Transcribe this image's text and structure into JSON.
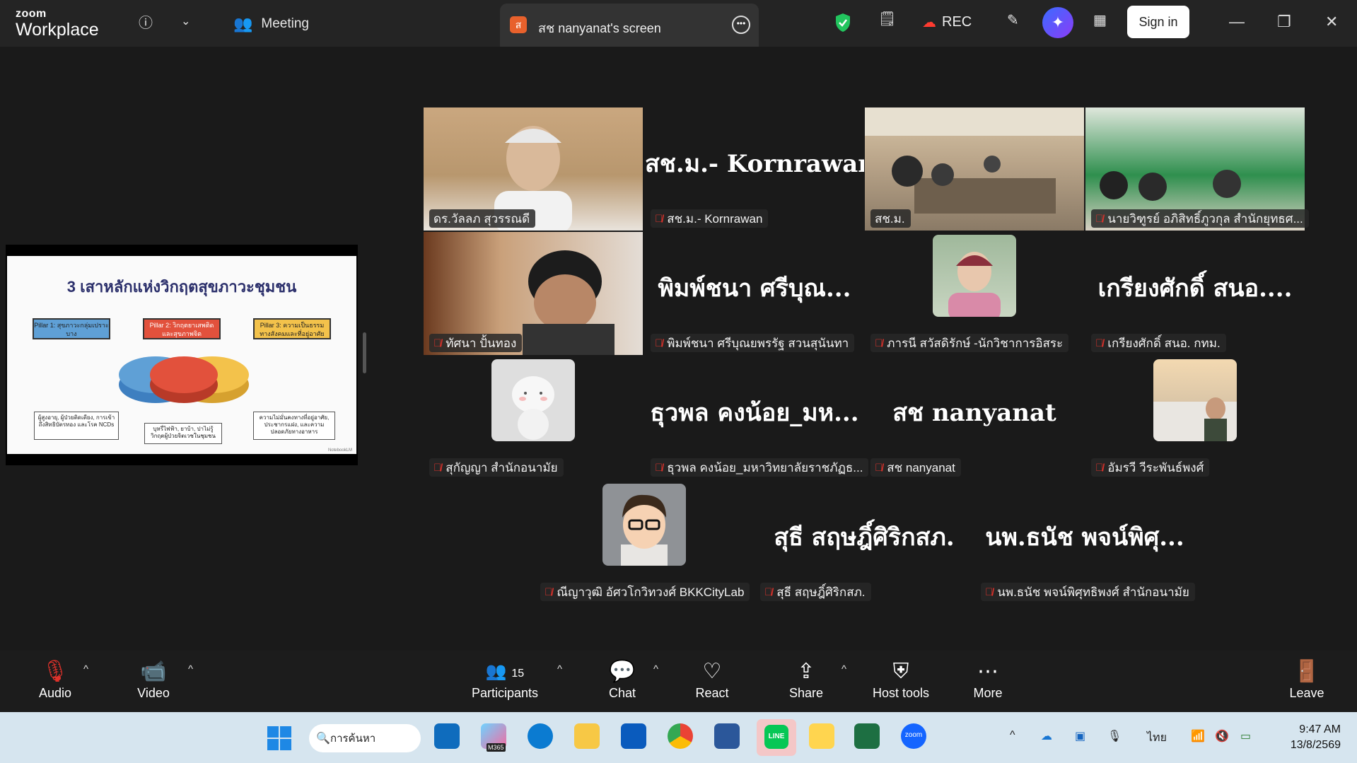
{
  "titlebar": {
    "brand_top": "zoom",
    "brand_bottom": "Workplace",
    "meeting_label": "Meeting",
    "screen_tab_avatar": "ส",
    "screen_tab_label": "สช nanyanat's screen",
    "rec_label": "REC",
    "signin_label": "Sign in",
    "icons": [
      "info-icon",
      "chevron-down-icon",
      "participants-icon",
      "more-icon",
      "shield-icon",
      "notes-icon",
      "cloud-rec-icon",
      "pen-icon",
      "ai-companion-icon",
      "layout-icon",
      "minimize-icon",
      "restore-icon",
      "close-icon"
    ]
  },
  "slide": {
    "title": "3 เสาหลักแห่งวิกฤตสุขภาวะชุมชน",
    "pillar1": "Pillar 1: สุขภาวะกลุ่มเปราะบาง",
    "pillar2": "Pillar 2: วิกฤตยาเสพติด และสุขภาพจิต",
    "pillar3": "Pillar 3: ความเป็นธรรม ทางสังคมและที่อยู่อาศัย",
    "note1": "ผู้สูงอายุ, ผู้ป่วยติดเตียง, การเข้าถึงสิทธิบัตรทอง และโรค NCDs",
    "note2": "บุหรี่ไฟฟ้า, ยาบ้า, ปาไม่รู้ วิกฤตผู้ป่วยจิตเวชในชุมชน",
    "note3": "ความไม่มั่นคงทางที่อยู่อาศัย, ประชากรแฝง, และความ ปลอดภัยทางอาหาร",
    "footer": "NotebookLM",
    "colors": {
      "pillar1": "#5fa0d6",
      "pillar2": "#e2513c",
      "pillar3": "#f3c24b"
    }
  },
  "participants": [
    {
      "name": "ดร.วัลลภ สุวรรณดี",
      "type": "video"
    },
    {
      "name": "สช.ม.- Kornrawan",
      "bigname": "สช.ม.- Kornrawan",
      "type": "name",
      "muted": true
    },
    {
      "name": "สช.ม.",
      "type": "video",
      "active": true
    },
    {
      "name": "นายวิฑูรย์ อภิสิทธิ์ภูวกุล สำนักยุทธศ...",
      "type": "video",
      "muted": true
    },
    {
      "name": "ทัศนา ปั้นทอง",
      "type": "video",
      "muted": true
    },
    {
      "name": "พิมพ์ชนา ศรีบุณยพรรัฐ สวนสุนันทา",
      "bigname": "พิมพ์ชนา ศรีบุณ...",
      "type": "name",
      "muted": true
    },
    {
      "name": "ภารนี สวัสดิรักษ์ -นักวิชาการอิสระ",
      "type": "photo",
      "muted": true
    },
    {
      "name": "เกรียงศักดิ์ สนอ. กทม.",
      "bigname": "เกรียงศักดิ์ สนอ....",
      "type": "name",
      "muted": true
    },
    {
      "name": "สุกัญญา สำนักอนามัย",
      "type": "photo",
      "muted": true
    },
    {
      "name": "ธุวพล คงน้อย_มหาวิทยาลัยราชภัฏธ...",
      "bigname": "ธุวพล คงน้อย_มห...",
      "type": "name",
      "muted": true
    },
    {
      "name": "สช nanyanat",
      "bigname": "สช nanyanat",
      "type": "name",
      "muted": true
    },
    {
      "name": "อัมรวี วีระพันธ์พงศ์",
      "type": "photo",
      "muted": true
    },
    {
      "name": "ณีญาวุฒิ อัศวโกวิทวงศ์ BKKCityLab",
      "type": "photo",
      "muted": true
    },
    {
      "name": "สุธี สฤษฎิ์ศิริกสภ.",
      "bigname": "สุธี สฤษฎิ์ศิริกสภ.",
      "type": "name",
      "muted": true
    },
    {
      "name": "นพ.ธนัช พจน์พิศุทธิพงศ์ สำนักอนามัย",
      "bigname": "นพ.ธนัช พจน์พิศุ...",
      "type": "name",
      "muted": true
    }
  ],
  "toolbar": {
    "audio": "Audio",
    "video": "Video",
    "participants": "Participants",
    "participants_count": "15",
    "chat": "Chat",
    "react": "React",
    "share": "Share",
    "host_tools": "Host tools",
    "more": "More",
    "leave": "Leave"
  },
  "taskbar": {
    "search_placeholder": "การค้นหา",
    "m365_badge": "M365",
    "zoom_app": "zoom",
    "line_app": "LINE",
    "lang": "ไทย",
    "time": "9:47 AM",
    "date": "13/8/2569"
  }
}
